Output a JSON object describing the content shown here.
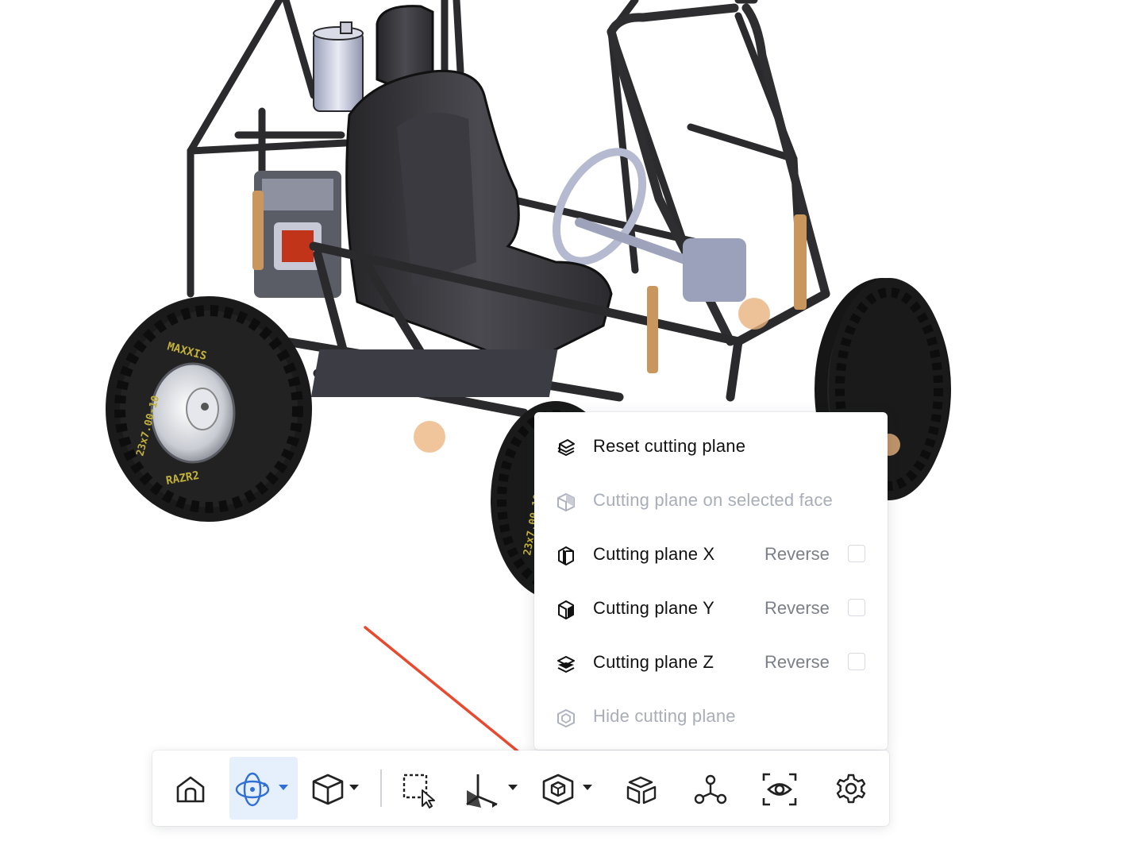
{
  "viewer": {
    "model": "buggy-cad-assembly",
    "tire_text": "23x7.00-10",
    "tire_brand_mirrored": "MAXXIS",
    "tire_tread_text": "RAZR2"
  },
  "cutting_plane_menu": {
    "items": [
      {
        "label": "Reset cutting plane",
        "icon": "reset-cutting-plane-icon",
        "enabled": true
      },
      {
        "label": "Cutting plane on selected face",
        "icon": "cutting-plane-face-icon",
        "enabled": false
      },
      {
        "label": "Cutting plane X",
        "icon": "cutting-plane-x-icon",
        "enabled": true,
        "reverse_label": "Reverse",
        "reverse_checked": false
      },
      {
        "label": "Cutting plane Y",
        "icon": "cutting-plane-y-icon",
        "enabled": true,
        "reverse_label": "Reverse",
        "reverse_checked": false
      },
      {
        "label": "Cutting plane Z",
        "icon": "cutting-plane-z-icon",
        "enabled": true,
        "reverse_label": "Reverse",
        "reverse_checked": false
      },
      {
        "label": "Hide cutting plane",
        "icon": "hide-cutting-plane-icon",
        "enabled": false
      }
    ]
  },
  "toolbar": {
    "buttons": [
      {
        "name": "home",
        "icon": "home-icon"
      },
      {
        "name": "orbit",
        "icon": "orbit-icon",
        "active": true,
        "dropdown": true
      },
      {
        "name": "view-cube",
        "icon": "cube-icon",
        "dropdown": true
      },
      {
        "name": "box-select",
        "icon": "box-select-icon"
      },
      {
        "name": "measure",
        "icon": "axes-icon",
        "dropdown": true
      },
      {
        "name": "section",
        "icon": "section-cube-icon",
        "dropdown": true
      },
      {
        "name": "explode",
        "icon": "explode-icon"
      },
      {
        "name": "model-tree",
        "icon": "tree-icon"
      },
      {
        "name": "visibility",
        "icon": "eye-icon"
      },
      {
        "name": "settings",
        "icon": "gear-icon"
      }
    ],
    "accent_color": "#2f6fd6"
  },
  "annotation": {
    "arrow_color": "#e8492f",
    "arrow_target": "section"
  }
}
